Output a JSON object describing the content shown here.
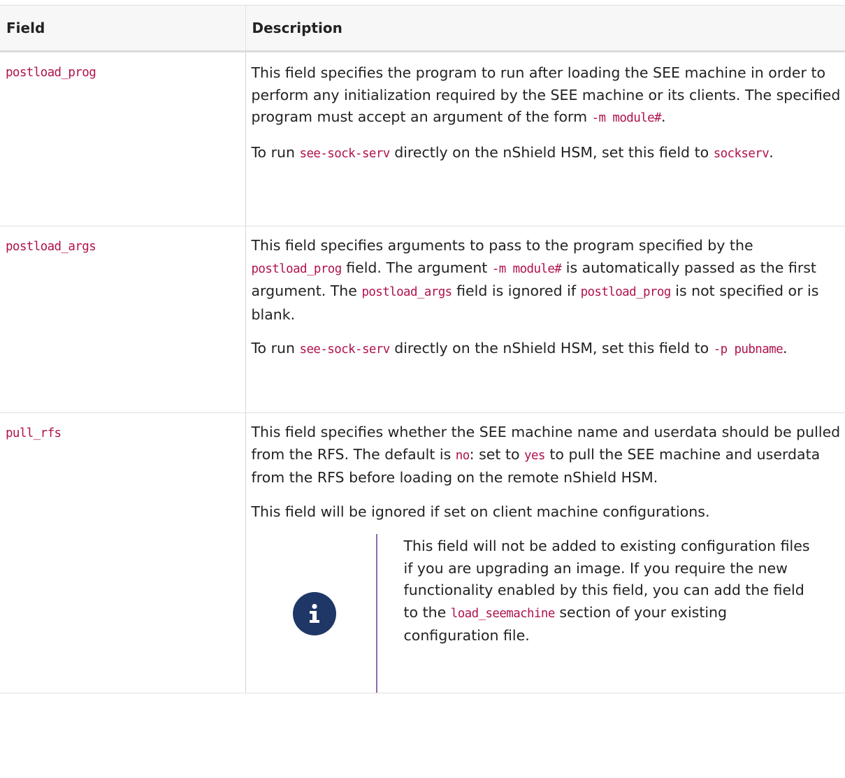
{
  "table": {
    "headers": {
      "field": "Field",
      "description": "Description"
    },
    "rows": {
      "postload_prog": {
        "field": "postload_prog",
        "p1_text1": "This field specifies the program to run after loading the SEE machine in order to perform any initialization required by the SEE machine or its clients. The specified program must accept an argument of the form ",
        "p1_code1": "-m module#",
        "p1_text2": ".",
        "p2_text1": "To run ",
        "p2_code1": "see-sock-serv",
        "p2_text2": " directly on the nShield HSM, set this field to ",
        "p2_code2": "sockserv",
        "p2_text3": "."
      },
      "postload_args": {
        "field": "postload_args",
        "p1_text1": "This field specifies arguments to pass to the program specified by the ",
        "p1_code1": "postload_prog",
        "p1_text2": " field. The argument ",
        "p1_code2": "-m module#",
        "p1_text3": " is automatically passed as the first argument. The ",
        "p1_code3": "postload_args",
        "p1_text4": " field is ignored if ",
        "p1_code4": "postload_prog",
        "p1_text5": " is not specified or is blank.",
        "p2_text1": "To run ",
        "p2_code1": "see-sock-serv",
        "p2_text2": " directly on the nShield HSM, set this field to ",
        "p2_code2": "-p pubname",
        "p2_text3": "."
      },
      "pull_rfs": {
        "field": "pull_rfs",
        "p1_text1": "This field specifies whether the SEE machine name and userdata should be pulled from the RFS. The default is ",
        "p1_code1": "no",
        "p1_text2": ": set to ",
        "p1_code2": "yes",
        "p1_text3": " to pull the SEE machine and userdata from the RFS before loading on the remote nShield HSM.",
        "p2_text": "This field will be ignored if set on client machine configurations.",
        "note": {
          "icon": "info-icon",
          "text1": "This field will not be added to existing configuration files if you are upgrading an image. If you require the new functionality enabled by this field, you can add the field to the ",
          "code1": "load_seemachine",
          "text2": " section of your existing configuration file."
        }
      }
    }
  },
  "colors": {
    "code": "#b0124e",
    "info_icon_bg": "#1f3766",
    "admonition_rule": "#8c6aa8",
    "header_bg": "#f7f7f7"
  }
}
